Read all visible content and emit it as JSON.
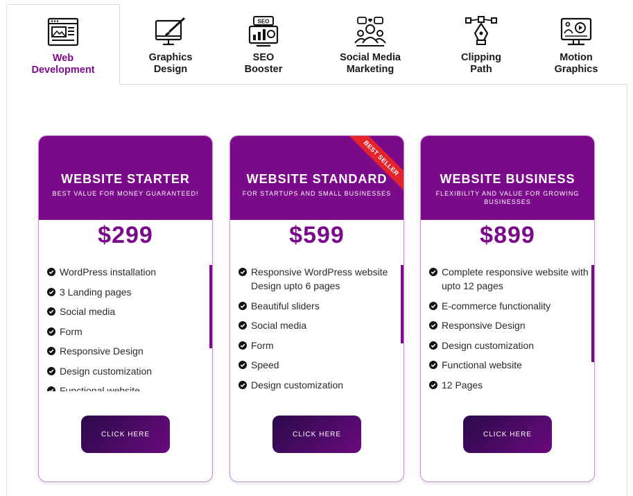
{
  "tabs": [
    {
      "label": "Web\nDevelopment",
      "icon": "web-development-icon",
      "active": true
    },
    {
      "label": "Graphics\nDesign",
      "icon": "graphics-design-icon",
      "active": false
    },
    {
      "label": "SEO\nBooster",
      "icon": "seo-booster-icon",
      "active": false
    },
    {
      "label": "Social Media\nMarketing",
      "icon": "social-media-icon",
      "active": false
    },
    {
      "label": "Clipping\nPath",
      "icon": "clipping-path-icon",
      "active": false
    },
    {
      "label": "Motion\nGraphics",
      "icon": "motion-graphics-icon",
      "active": false
    }
  ],
  "colors": {
    "accent": "#7b0a8b",
    "ribbon": "#e4242b",
    "button_start": "#2a0a4a",
    "button_end": "#6a0a7e"
  },
  "plans": [
    {
      "title": "WEBSITE STARTER",
      "subtitle": "BEST VALUE FOR MONEY GUARANTEED!",
      "price": "$299",
      "features": [
        "WordPress installation",
        "3 Landing pages",
        "Social media",
        "Form",
        "Responsive Design",
        "Design customization",
        "Functional website"
      ],
      "button": "CLICK HERE"
    },
    {
      "title": "WEBSITE STANDARD",
      "subtitle": "FOR STARTUPS AND SMALL BUSINESSES",
      "price": "$599",
      "ribbon": "BEST SELLER",
      "features": [
        "Responsive WordPress website Design upto 6 pages",
        "Beautiful sliders",
        "Social media",
        "Form",
        "Speed",
        "Design customization"
      ],
      "button": "CLICK HERE"
    },
    {
      "title": "WEBSITE BUSINESS",
      "subtitle": "FLEXIBILITY AND VALUE FOR GROWING BUSINESSES",
      "price": "$899",
      "features": [
        "Complete responsive website with upto 12 pages",
        "E-commerce functionality",
        "Responsive Design",
        "Design customization",
        "Functional website",
        "12 Pages"
      ],
      "button": "CLICK HERE"
    }
  ]
}
